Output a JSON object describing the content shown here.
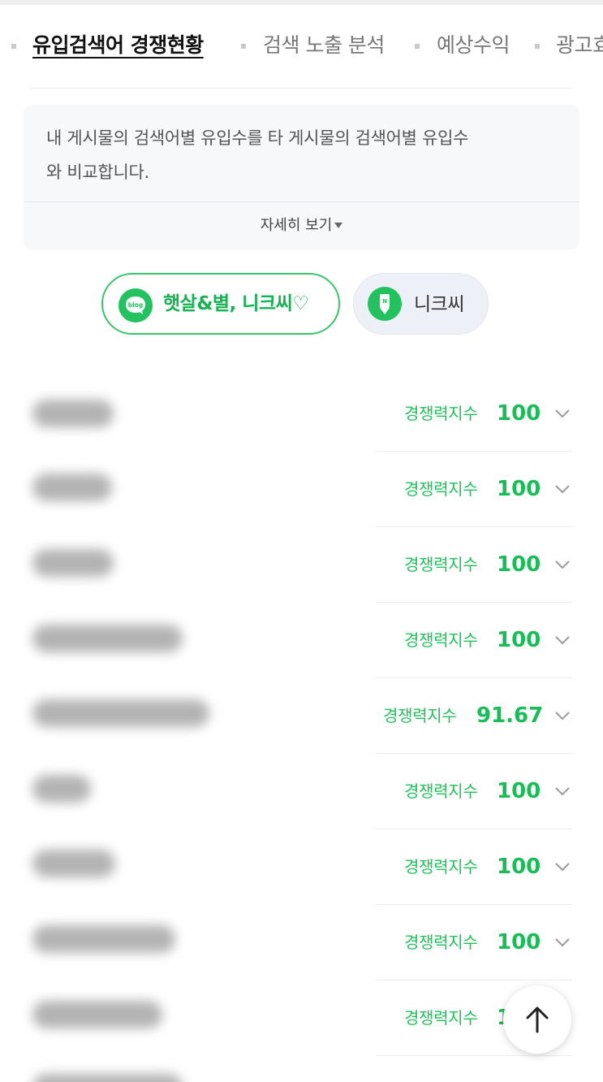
{
  "tabs": [
    {
      "label": "유입검색어 경쟁현황",
      "active": true
    },
    {
      "label": "검색 노출 분석",
      "active": false
    },
    {
      "label": "예상수익",
      "active": false
    },
    {
      "label": "광고효",
      "active": false
    }
  ],
  "info": {
    "line1": "내 게시물의 검색어별 유입수를 타 게시물의 검색어별 유입수",
    "line2": "와 비교합니다.",
    "more_label": "자세히 보기"
  },
  "chips": {
    "blog": {
      "label": "햇살&별, 니크씨♡",
      "icon": "blog-icon"
    },
    "user": {
      "label": "니크씨",
      "icon": "pen-badge-icon"
    }
  },
  "rows": [
    {
      "score_label": "경쟁력지수",
      "score": "100"
    },
    {
      "score_label": "경쟁력지수",
      "score": "100"
    },
    {
      "score_label": "경쟁력지수",
      "score": "100"
    },
    {
      "score_label": "경쟁력지수",
      "score": "100"
    },
    {
      "score_label": "경쟁력지수",
      "score": "91.67"
    },
    {
      "score_label": "경쟁력지수",
      "score": "100"
    },
    {
      "score_label": "경쟁력지수",
      "score": "100"
    },
    {
      "score_label": "경쟁력지수",
      "score": "100"
    },
    {
      "score_label": "경쟁력지수",
      "score": "100"
    }
  ],
  "colors": {
    "accent_green": "#1ec35a",
    "chip_border": "#36c768"
  }
}
